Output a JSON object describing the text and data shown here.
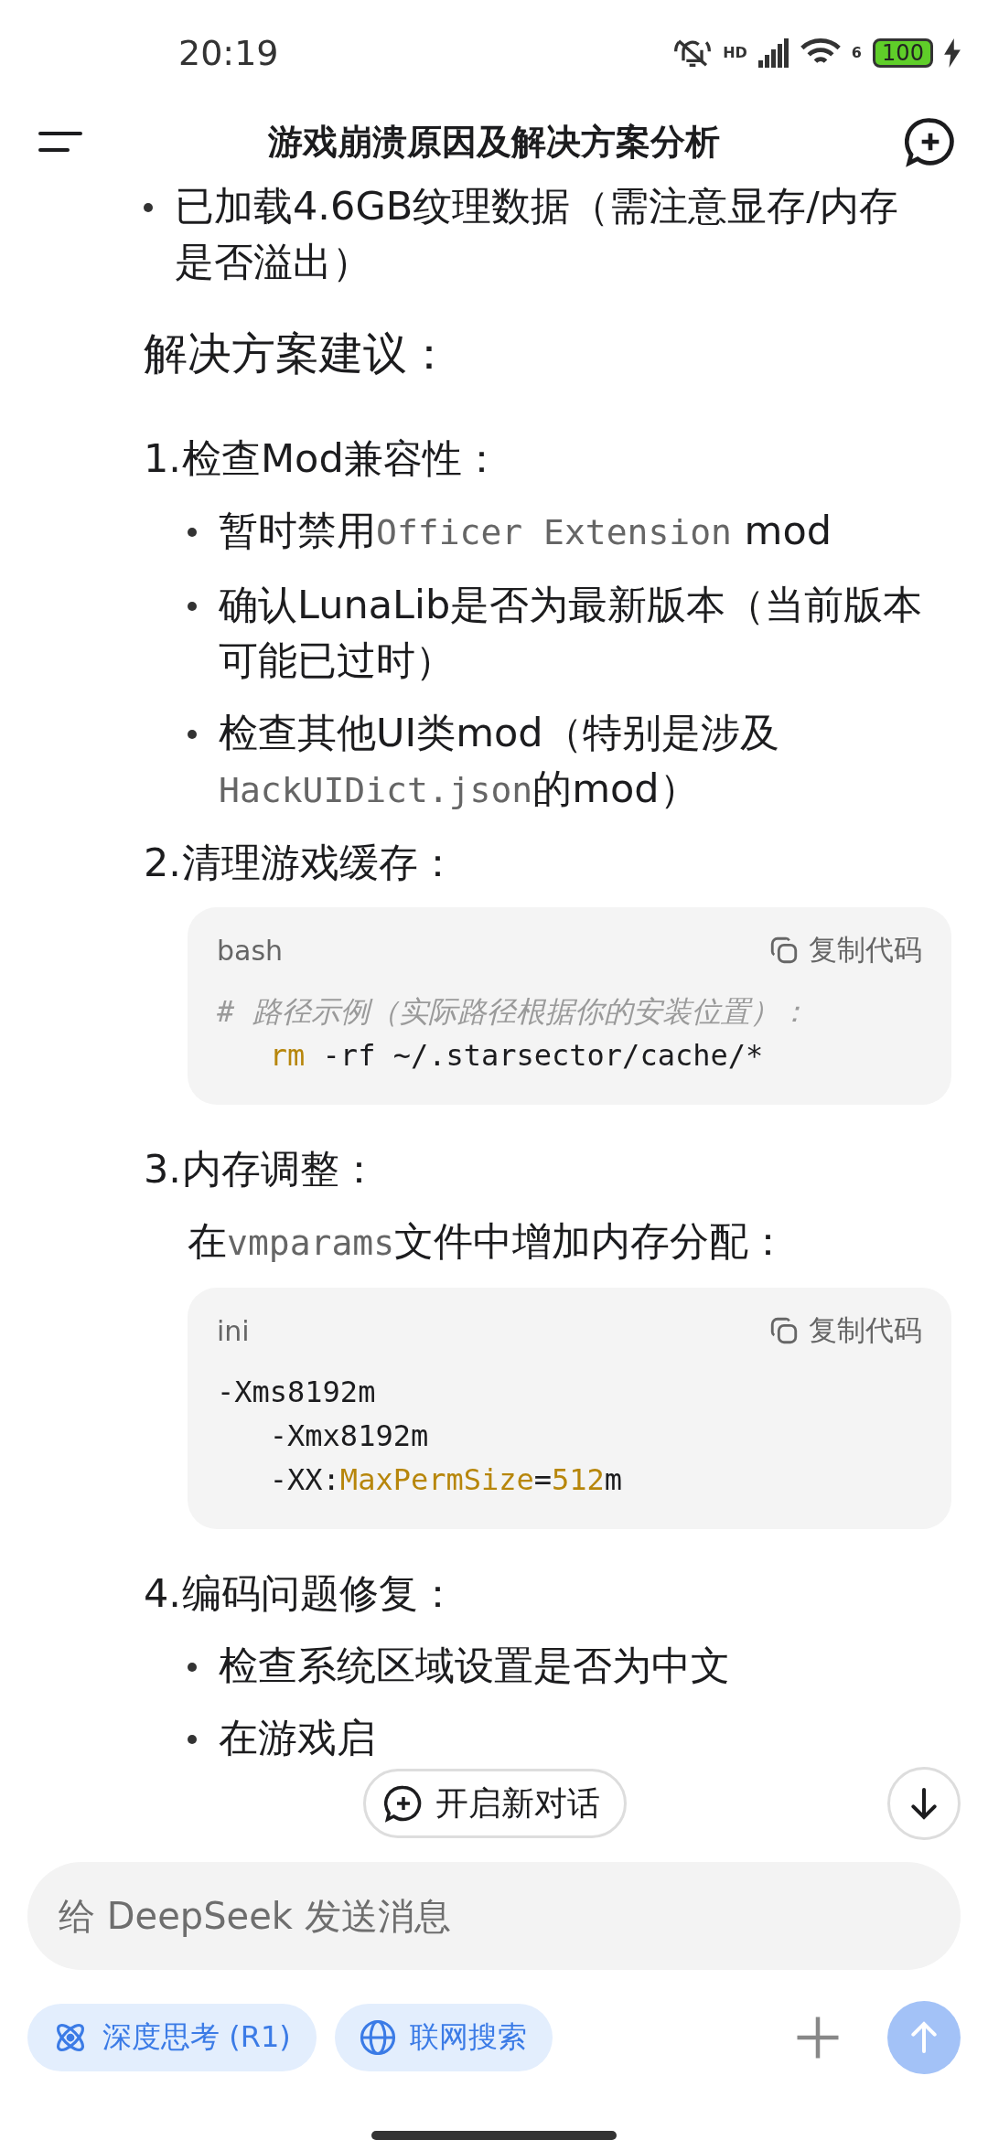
{
  "status_bar": {
    "time": "20:19",
    "signal_label": "HD",
    "wifi_label": "6",
    "battery": "100"
  },
  "header": {
    "title": "游戏崩溃原因及解决方案分析"
  },
  "answer": [
    {
      "kind": "bullet",
      "segments": [
        {
          "text": "已加载4.6GB纹理数据（需注意显存/内存是否溢出）",
          "kind": "text"
        }
      ]
    },
    {
      "kind": "heading",
      "text": "解决方案建议："
    },
    {
      "kind": "step",
      "number": "1.",
      "title": "检查Mod兼容性：",
      "items": [
        {
          "kind": "bullet",
          "segments": [
            {
              "text": "暂时禁用",
              "kind": "text"
            },
            {
              "text": "Officer Extension",
              "kind": "code"
            },
            {
              "text": " mod",
              "kind": "text"
            }
          ]
        },
        {
          "kind": "bullet",
          "segments": [
            {
              "text": "确认LunaLib是否为最新版本（当前版本可能已过时）",
              "kind": "text"
            }
          ]
        },
        {
          "kind": "bullet",
          "segments": [
            {
              "text": "检查其他UI类mod（特别是涉及",
              "kind": "text"
            },
            {
              "text": "HackUIDict.json",
              "kind": "code"
            },
            {
              "text": "的mod）",
              "kind": "text"
            }
          ]
        }
      ]
    },
    {
      "kind": "step",
      "number": "2.",
      "title": "清理游戏缓存：",
      "items": [
        {
          "kind": "code",
          "lang": "bash",
          "copy_label": "复制代码",
          "lines": [
            [
              {
                "text": "# 路径示例（实际路径根据你的安装位置）：",
                "kind": "comment"
              }
            ],
            [
              {
                "text": "   rm",
                "kind": "keyword"
              },
              {
                "text": " -rf ~/.starsector/cache/*",
                "kind": "plain"
              }
            ]
          ]
        }
      ]
    },
    {
      "kind": "step",
      "number": "3.",
      "title": "内存调整：",
      "items": [
        {
          "kind": "paragraph",
          "segments": [
            {
              "text": "在",
              "kind": "text"
            },
            {
              "text": "vmparams",
              "kind": "code"
            },
            {
              "text": "文件中增加内存分配：",
              "kind": "text"
            }
          ]
        },
        {
          "kind": "code",
          "lang": "ini",
          "copy_label": "复制代码",
          "lines": [
            [
              {
                "text": "-Xms8192m",
                "kind": "plain"
              }
            ],
            [
              {
                "text": "   -Xmx8192m",
                "kind": "plain"
              }
            ],
            [
              {
                "text": "   -XX:",
                "kind": "plain"
              },
              {
                "text": "MaxPermSize",
                "kind": "keyword"
              },
              {
                "text": "=",
                "kind": "plain"
              },
              {
                "text": "512",
                "kind": "keyword"
              },
              {
                "text": "m",
                "kind": "plain"
              }
            ]
          ]
        }
      ]
    },
    {
      "kind": "step",
      "number": "4.",
      "title": "编码问题修复：",
      "items": [
        {
          "kind": "bullet",
          "segments": [
            {
              "text": "检查系统区域设置是否为中文",
              "kind": "text"
            }
          ]
        },
        {
          "kind": "bullet",
          "segments": [
            {
              "text": "在游戏启",
              "kind": "text"
            }
          ]
        }
      ]
    }
  ],
  "new_chat_button": "开启新对话",
  "composer": {
    "placeholder": "给 DeepSeek 发送消息",
    "chips": [
      {
        "kind": "deepthink",
        "label": "深度思考 (R1)",
        "selected": false
      },
      {
        "kind": "search",
        "label": "联网搜索",
        "selected": false
      }
    ]
  }
}
